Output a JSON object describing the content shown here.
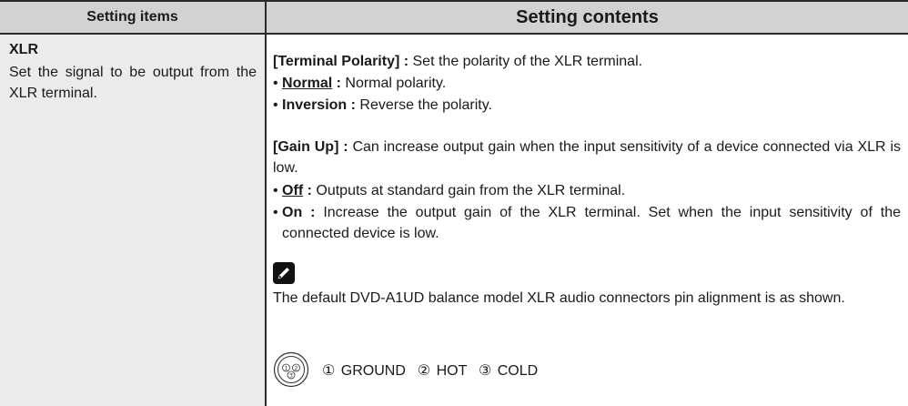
{
  "header": {
    "col1": "Setting items",
    "col2": "Setting contents"
  },
  "item": {
    "title": "XLR",
    "description": "Set the signal to be output from the XLR terminal."
  },
  "polarity": {
    "heading": "[Terminal Polarity] :",
    "heading_desc": " Set the polarity of the XLR terminal.",
    "opt1_label": "Normal",
    "opt1_sep": " :",
    "opt1_desc": " Normal polarity.",
    "opt2_label": "Inversion :",
    "opt2_desc": " Reverse the polarity."
  },
  "gain": {
    "heading": "[Gain Up] :",
    "heading_desc": " Can increase output gain when the input sensitivity of a device connected via XLR is low.",
    "off_label": "Off",
    "off_sep": " :",
    "off_desc": " Outputs at standard gain from the XLR terminal.",
    "on_label": "On :",
    "on_desc": " Increase the output gain of the XLR terminal. Set when the input sensitivity of the connected device is low."
  },
  "note": {
    "icon": "pencil-icon",
    "text": "The default DVD-A1UD balance model XLR audio connectors pin alignment is as shown."
  },
  "connector": {
    "icon": "xlr-connector-icon",
    "pins": [
      "1",
      "2",
      "3"
    ],
    "legend": "① GROUND  ② HOT  ③ COLD"
  }
}
